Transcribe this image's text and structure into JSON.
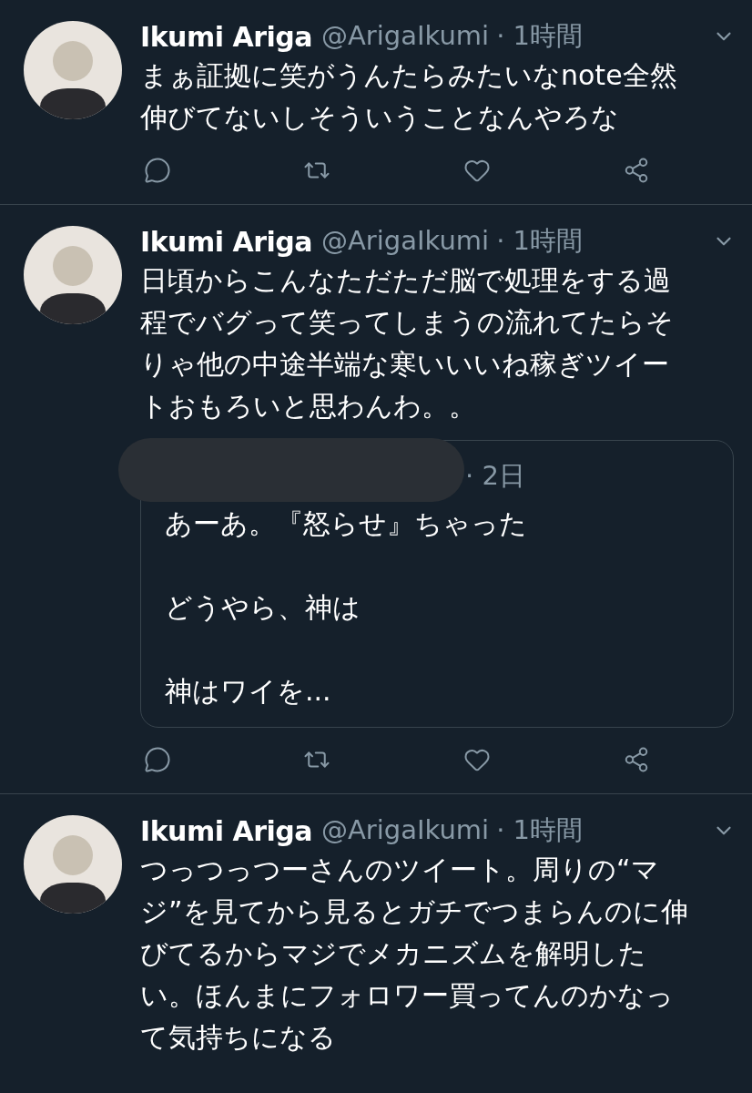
{
  "tweets": [
    {
      "name": "Ikumi Ariga",
      "handle": "@ArigaIkumi",
      "time": "· 1時間",
      "lines": [
        "まぁ証拠に笑がうんたらみたいなnote全然",
        "伸びてないしそういうことなんやろな"
      ],
      "actions": true
    },
    {
      "name": "Ikumi Ariga",
      "handle": "@ArigaIkumi",
      "time": "· 1時間",
      "lines": [
        "日頃からこんなただただ脳で処理をする過",
        "程でバグって笑ってしまうの流れてたらそ",
        "りゃ他の中途半端な寒いいいね稼ぎツイー",
        "トおもろいと思わんわ。。"
      ],
      "quote": {
        "time": "· 2日",
        "paragraphs": [
          "あーあ。『怒らせ』ちゃった",
          "どうやら、神は",
          "神はワイを..."
        ]
      },
      "actions": true
    },
    {
      "name": "Ikumi Ariga",
      "handle": "@ArigaIkumi",
      "time": "· 1時間",
      "lines": [
        "つっつっつーさんのツイート。周りの“マ",
        "ジ”を見てから見るとガチでつまらんのに伸",
        "びてるからマジでメカニズムを解明した",
        "い。ほんまにフォロワー買ってんのかなっ",
        "て気持ちになる"
      ],
      "actions": false
    }
  ]
}
